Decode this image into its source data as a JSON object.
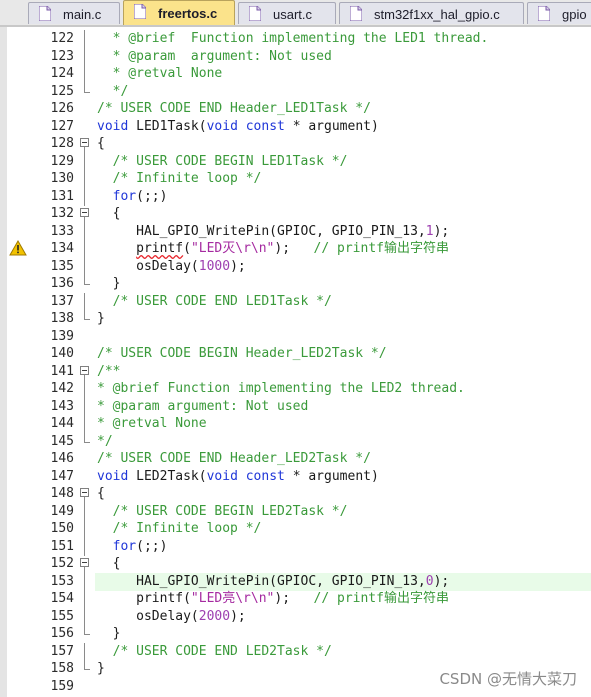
{
  "tabs": [
    {
      "label": "main.c",
      "active": false
    },
    {
      "label": "freertos.c",
      "active": true
    },
    {
      "label": "usart.c",
      "active": false
    },
    {
      "label": "stm32f1xx_hal_gpio.c",
      "active": false
    },
    {
      "label": "gpio",
      "active": false
    }
  ],
  "lines": [
    {
      "num": "122",
      "text": "  * @brief  Function implementing the LED1 thread."
    },
    {
      "num": "123",
      "text": "  * @param  argument: Not used"
    },
    {
      "num": "124",
      "text": "  * @retval None"
    },
    {
      "num": "125",
      "text": "  */"
    },
    {
      "num": "126",
      "text": "/* USER CODE END Header_LED1Task */"
    },
    {
      "num": "127",
      "text": "void LED1Task(void const * argument)"
    },
    {
      "num": "128",
      "text": "{"
    },
    {
      "num": "129",
      "text": "  /* USER CODE BEGIN LED1Task */"
    },
    {
      "num": "130",
      "text": "  /* Infinite loop */"
    },
    {
      "num": "131",
      "text": "  for(;;)"
    },
    {
      "num": "132",
      "text": "  {"
    },
    {
      "num": "133",
      "text": "     HAL_GPIO_WritePin(GPIOC, GPIO_PIN_13,1);"
    },
    {
      "num": "134",
      "text": "     printf(\"LED灭\\r\\n\");   // printf输出字符串"
    },
    {
      "num": "135",
      "text": "     osDelay(1000);"
    },
    {
      "num": "136",
      "text": "  }"
    },
    {
      "num": "137",
      "text": "  /* USER CODE END LED1Task */"
    },
    {
      "num": "138",
      "text": "}"
    },
    {
      "num": "139",
      "text": ""
    },
    {
      "num": "140",
      "text": "/* USER CODE BEGIN Header_LED2Task */"
    },
    {
      "num": "141",
      "text": "/**"
    },
    {
      "num": "142",
      "text": "* @brief Function implementing the LED2 thread."
    },
    {
      "num": "143",
      "text": "* @param argument: Not used"
    },
    {
      "num": "144",
      "text": "* @retval None"
    },
    {
      "num": "145",
      "text": "*/"
    },
    {
      "num": "146",
      "text": "/* USER CODE END Header_LED2Task */"
    },
    {
      "num": "147",
      "text": "void LED2Task(void const * argument)"
    },
    {
      "num": "148",
      "text": "{"
    },
    {
      "num": "149",
      "text": "  /* USER CODE BEGIN LED2Task */"
    },
    {
      "num": "150",
      "text": "  /* Infinite loop */"
    },
    {
      "num": "151",
      "text": "  for(;;)"
    },
    {
      "num": "152",
      "text": "  {"
    },
    {
      "num": "153",
      "text": "     HAL_GPIO_WritePin(GPIOC, GPIO_PIN_13,0);"
    },
    {
      "num": "154",
      "text": "     printf(\"LED亮\\r\\n\");   // printf输出字符串"
    },
    {
      "num": "155",
      "text": "     osDelay(2000);"
    },
    {
      "num": "156",
      "text": "  }"
    },
    {
      "num": "157",
      "text": "  /* USER CODE END LED2Task */"
    },
    {
      "num": "158",
      "text": "}"
    },
    {
      "num": "159",
      "text": ""
    }
  ],
  "warning_line": "134",
  "current_line": "153",
  "watermark": "CSDN @无情大菜刀",
  "colors": {
    "comment": "#3a9a3a",
    "keyword": "#1f36d8",
    "number": "#9d3fb0",
    "string": "#a52aa0",
    "active_tab": "#fbe38b",
    "current_line_bg": "#e8fbe8",
    "warning": "#f2c200"
  },
  "icons": {
    "tab_file": "c-file-icon",
    "warning": "warning-triangle-icon",
    "fold": "fold-minus-icon"
  }
}
